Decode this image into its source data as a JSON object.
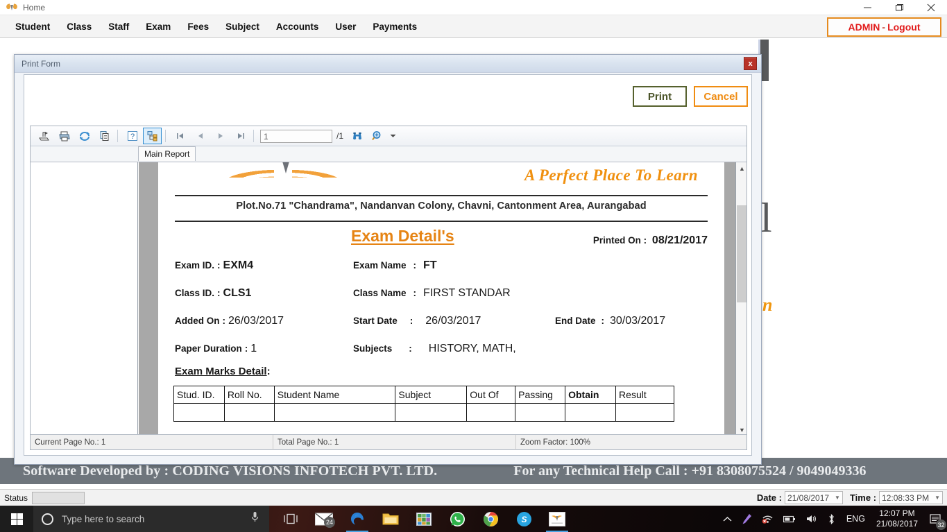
{
  "window": {
    "title": "Home",
    "minimize_label": "Minimize",
    "maximize_label": "Maximize",
    "close_label": "Close"
  },
  "menu": {
    "items": [
      {
        "label": "Student"
      },
      {
        "label": "Class"
      },
      {
        "label": "Staff"
      },
      {
        "label": "Exam"
      },
      {
        "label": "Fees"
      },
      {
        "label": "Subject"
      },
      {
        "label": "Accounts"
      },
      {
        "label": "User"
      },
      {
        "label": "Payments"
      }
    ],
    "logout": {
      "user": "ADMIN",
      "separator": "-",
      "action": "Logout",
      "border_color": "#e58a1e",
      "text_color": "#e11b1b"
    }
  },
  "print_form": {
    "title": "Print Form",
    "close_glyph": "x",
    "print_button": "Print",
    "cancel_button": "Cancel",
    "print_border_color": "#55602d",
    "cancel_border_color": "#f08c11"
  },
  "viewer": {
    "toolbar_icons": [
      {
        "name": "export-icon"
      },
      {
        "name": "print-icon"
      },
      {
        "name": "refresh-icon"
      },
      {
        "name": "copy-icon"
      },
      {
        "name": "help-icon"
      },
      {
        "name": "toggle-group-tree-icon"
      }
    ],
    "nav": {
      "first": "first-page",
      "previous": "previous-page",
      "next": "next-page",
      "last": "last-page"
    },
    "page_value": "1",
    "page_total": "/1",
    "search_icon": "binoculars-icon",
    "zoom_icon": "zoom-icon",
    "tab_label": "Main Report",
    "status": {
      "current_page": "Current Page No.: 1",
      "total_page": "Total Page No.: 1",
      "zoom_factor": "Zoom Factor: 100%"
    }
  },
  "report": {
    "tagline": "A Perfect Place To Learn",
    "address": "Plot.No.71 \"Chandrama\", Nandanvan Colony, Chavni, Cantonment Area, Aurangabad",
    "heading": "Exam Detail's",
    "printed_on_label": "Printed On",
    "printed_on_value": "08/21/2017",
    "colon": ":",
    "fields": {
      "exam_id_label": "Exam ID.",
      "exam_id_value": "EXM4",
      "exam_name_label": "Exam Name",
      "exam_name_value": "FT",
      "class_id_label": "Class ID.",
      "class_id_value": "CLS1",
      "class_name_label": "Class Name",
      "class_name_value": "FIRST STANDAR",
      "added_on_label": "Added On",
      "added_on_value": "26/03/2017",
      "start_date_label": "Start Date",
      "start_date_value": "26/03/2017",
      "end_date_label": "End Date",
      "end_date_value": "30/03/2017",
      "paper_duration_label": "Paper Duration",
      "paper_duration_value": "1",
      "subjects_label": "Subjects",
      "subjects_value": "HISTORY, MATH,"
    },
    "marks_heading": "Exam Marks Detail",
    "marks_heading_colon": ":",
    "marks_table": {
      "columns": [
        "Stud. ID.",
        "Roll No.",
        "Student Name",
        "Subject",
        "Out Of",
        "Passing",
        "Obtain",
        "Result"
      ],
      "rows": [
        [
          "",
          "",
          "",
          "",
          "",
          "",
          "",
          ""
        ]
      ]
    },
    "heading_color": "#e68414",
    "tagline_color": "#f0900f"
  },
  "footer": {
    "developed_by": "Software Developed by : CODING VISIONS INFOTECH PVT. LTD.",
    "support": "For any Technical Help Call : +91 8308075524 / 9049049336"
  },
  "statusbar": {
    "status_label": "Status",
    "status_value": "",
    "date_label": "Date :",
    "date_value": "21/08/2017",
    "time_label": "Time :",
    "time_value": "12:08:33 PM"
  },
  "taskbar": {
    "search_placeholder": "Type here to search",
    "apps": [
      {
        "name": "task-view-icon"
      },
      {
        "name": "mail-icon",
        "badge": "24"
      },
      {
        "name": "edge-icon"
      },
      {
        "name": "file-explorer-icon"
      },
      {
        "name": "excel-icon"
      },
      {
        "name": "whatsapp-icon"
      },
      {
        "name": "chrome-icon"
      },
      {
        "name": "skype-icon"
      },
      {
        "name": "school-app-icon"
      }
    ],
    "tray": {
      "language": "ENG",
      "time": "12:07 PM",
      "date": "21/08/2017",
      "notification_count": "32"
    }
  }
}
